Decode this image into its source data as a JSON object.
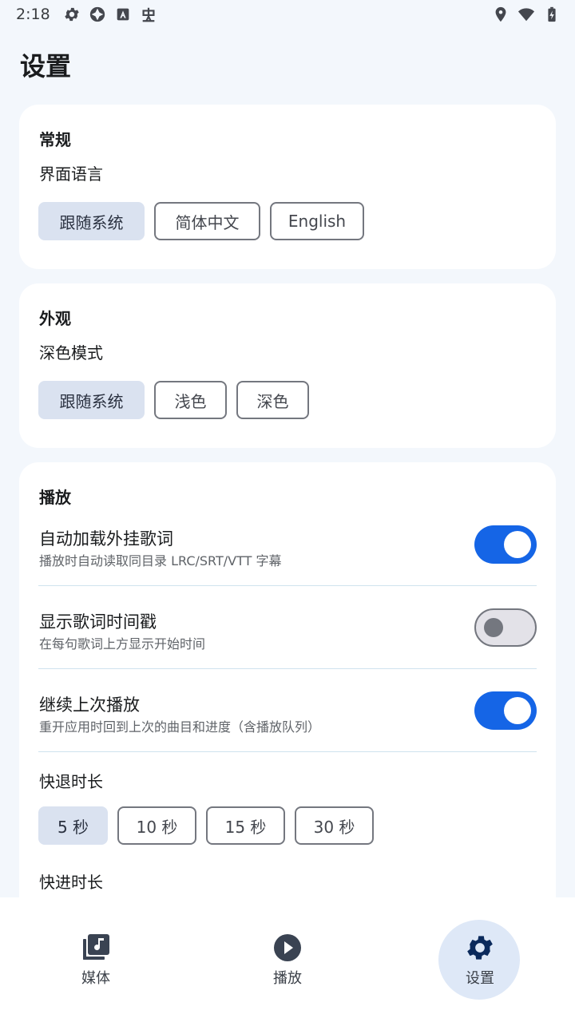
{
  "status_bar": {
    "time": "2:18",
    "left_icons": [
      "gear-icon",
      "aperture-icon",
      "translate-icon",
      "bug-icon"
    ],
    "right_icons": [
      "location-icon",
      "wifi-icon",
      "battery-icon"
    ]
  },
  "page": {
    "title": "设置"
  },
  "general": {
    "title": "常规",
    "subtitle": "界面语言",
    "options": [
      "跟随系统",
      "简体中文",
      "English"
    ],
    "selected": "跟随系统"
  },
  "appearance": {
    "title": "外观",
    "subtitle": "深色模式",
    "options": [
      "跟随系统",
      "浅色",
      "深色"
    ],
    "selected": "跟随系统"
  },
  "playback": {
    "title": "播放",
    "rows": [
      {
        "title": "自动加载外挂歌词",
        "desc": "播放时自动读取同目录 LRC/SRT/VTT 字幕",
        "enabled": true
      },
      {
        "title": "显示歌词时间戳",
        "desc": "在每句歌词上方显示开始时间",
        "enabled": false
      },
      {
        "title": "继续上次播放",
        "desc": "重开应用时回到上次的曲目和进度（含播放队列）",
        "enabled": true
      }
    ],
    "rewind_label": "快退时长",
    "rewind_options": [
      "5 秒",
      "10 秒",
      "15 秒",
      "30 秒"
    ],
    "rewind_selected": "5 秒",
    "forward_label": "快进时长"
  },
  "bottom_nav": {
    "items": [
      {
        "label": "媒体",
        "icon": "music-library-icon"
      },
      {
        "label": "播放",
        "icon": "play-circle-icon"
      },
      {
        "label": "设置",
        "icon": "gear-icon"
      }
    ],
    "active": "设置"
  },
  "colors": {
    "accent": "#1565e6",
    "background": "#f3f7fc",
    "chip_selected": "#dae2f0",
    "nav_active": "#dee8f7"
  }
}
